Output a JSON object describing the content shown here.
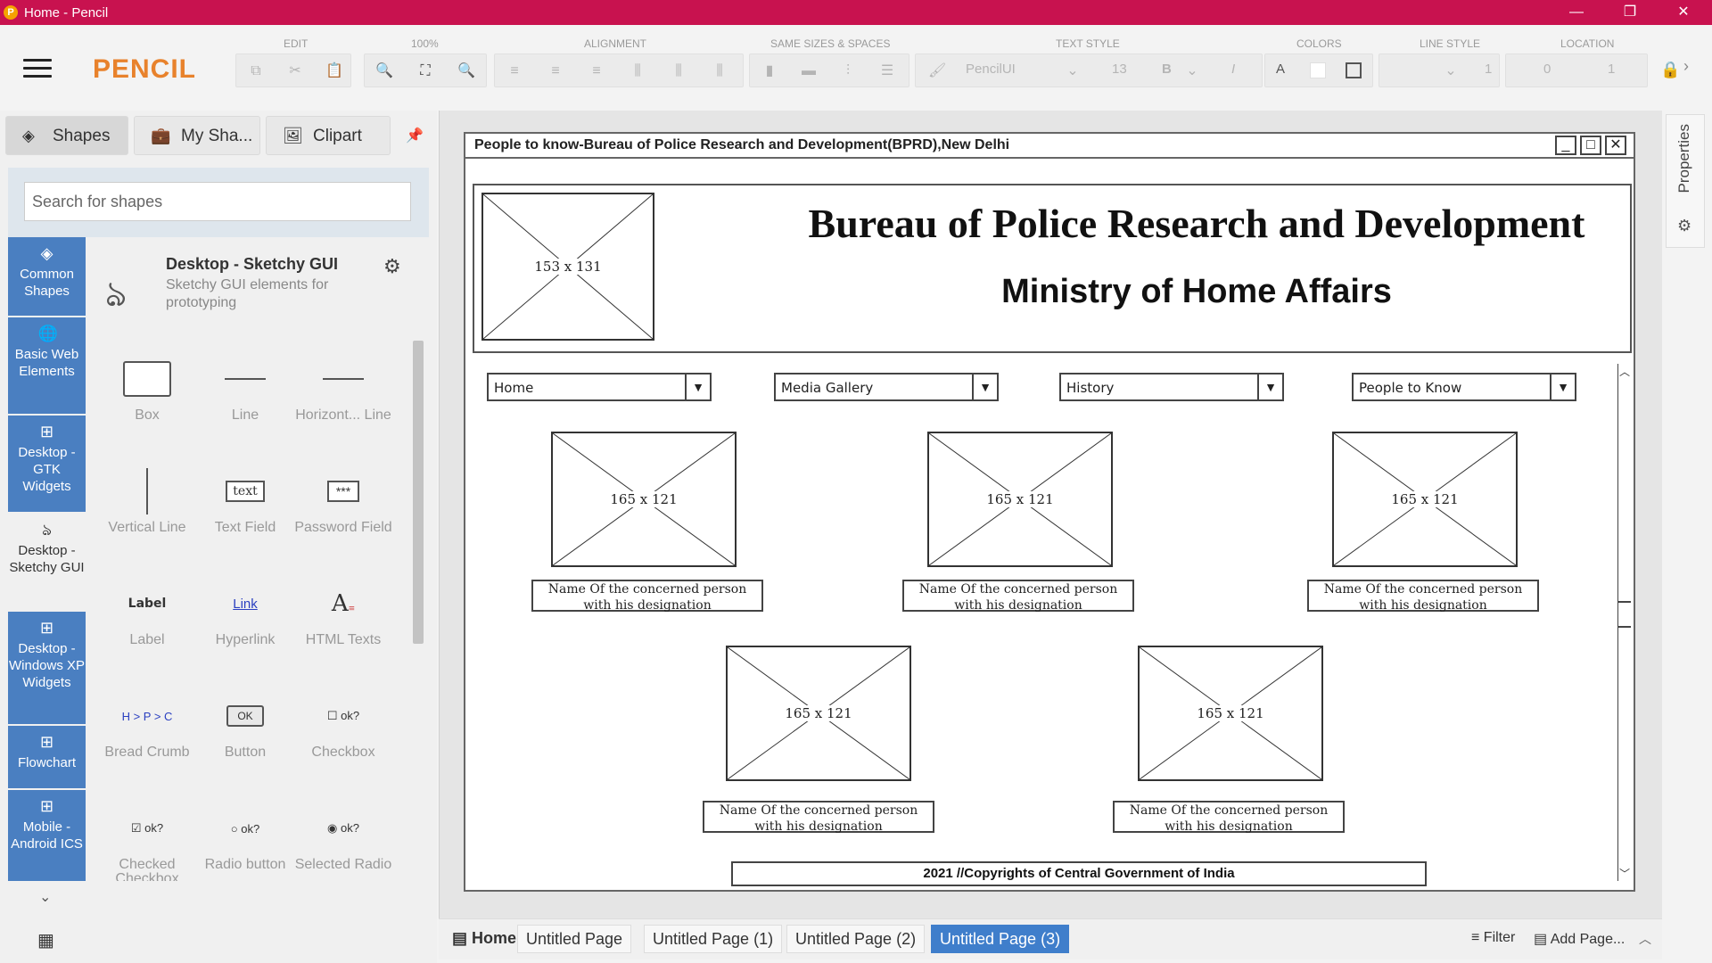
{
  "window": {
    "title": "Home - Pencil",
    "minimize": "—",
    "maximize": "❐",
    "close": "✕"
  },
  "toolbar": {
    "logo": "PENCIL",
    "groups": {
      "edit": "EDIT",
      "zoom": "100%",
      "alignment": "ALIGNMENT",
      "same_sizes": "SAME SIZES & SPACES",
      "text_style": "TEXT STYLE",
      "colors": "COLORS",
      "line_style": "LINE STYLE",
      "location": "LOCATION"
    },
    "font_name": "PencilUI",
    "font_size": "13",
    "bold": "B",
    "italic": "I",
    "text_color": "A",
    "line_width": "1",
    "location_x": "0",
    "location_y": "1"
  },
  "left_panel": {
    "tabs": [
      {
        "label": "Shapes",
        "icon": "layers-icon"
      },
      {
        "label": "My Sha...",
        "icon": "briefcase-icon"
      },
      {
        "label": "Clipart",
        "icon": "image-icon"
      }
    ],
    "search_placeholder": "Search for shapes",
    "categories": [
      {
        "label": "Common Shapes",
        "icon": "layers-icon"
      },
      {
        "label": "Basic Web Elements",
        "icon": "globe-icon"
      },
      {
        "label": "Desktop - GTK Widgets",
        "icon": "grid-icon"
      },
      {
        "label": "Desktop - Sketchy GUI",
        "icon": "squiggle-icon"
      },
      {
        "label": "Desktop - Windows XP Widgets",
        "icon": "grid-icon"
      },
      {
        "label": "Flowchart",
        "icon": "grid-icon"
      },
      {
        "label": "Mobile - Android ICS",
        "icon": "grid-icon"
      }
    ],
    "collection": {
      "title": "Desktop - Sketchy GUI",
      "description": "Sketchy GUI elements for prototyping"
    },
    "shapes": [
      {
        "label": "Box"
      },
      {
        "label": "Line"
      },
      {
        "label": "Horizont... Line"
      },
      {
        "label": "Vertical Line"
      },
      {
        "label": "Text Field",
        "preview": "text"
      },
      {
        "label": "Password Field",
        "preview": "***"
      },
      {
        "label": "Label",
        "preview": "Label"
      },
      {
        "label": "Hyperlink",
        "preview": "Link"
      },
      {
        "label": "HTML Texts"
      },
      {
        "label": "Bread Crumb",
        "preview": "H > P > C"
      },
      {
        "label": "Button",
        "preview": "OK"
      },
      {
        "label": "Checkbox",
        "preview": "ok?"
      },
      {
        "label": "Checked Checkbox",
        "preview": "ok?"
      },
      {
        "label": "Radio button",
        "preview": "ok?"
      },
      {
        "label": "Selected Radio",
        "preview": "ok?"
      }
    ]
  },
  "mockup": {
    "window_title": "People to know-Bureau of Police Research and Development(BPRD),New Delhi",
    "logo_placeholder": "153 x 131",
    "heading": "Bureau of Police Research and Development",
    "subheading": "Ministry of Home Affairs",
    "nav": [
      "Home",
      "Media Gallery",
      "History",
      "People to Know"
    ],
    "photo_placeholder": "165 x 121",
    "person_caption_line1": "Name Of the concerned person",
    "person_caption_line2": "with his designation",
    "footer": "2021 //Copyrights of Central Government of India"
  },
  "right_panel": {
    "properties_label": "Properties"
  },
  "pages": {
    "home": "Home",
    "tabs": [
      "Untitled Page",
      "Untitled Page (1)",
      "Untitled Page (2)",
      "Untitled Page (3)"
    ],
    "active_index": 3,
    "filter": "Filter",
    "add_page": "Add Page..."
  },
  "colors": {
    "titlebar": "#c8124f",
    "logo": "#e8822c",
    "category_active": "#4a7fc1",
    "page_tab_active": "#3f7ecb"
  }
}
